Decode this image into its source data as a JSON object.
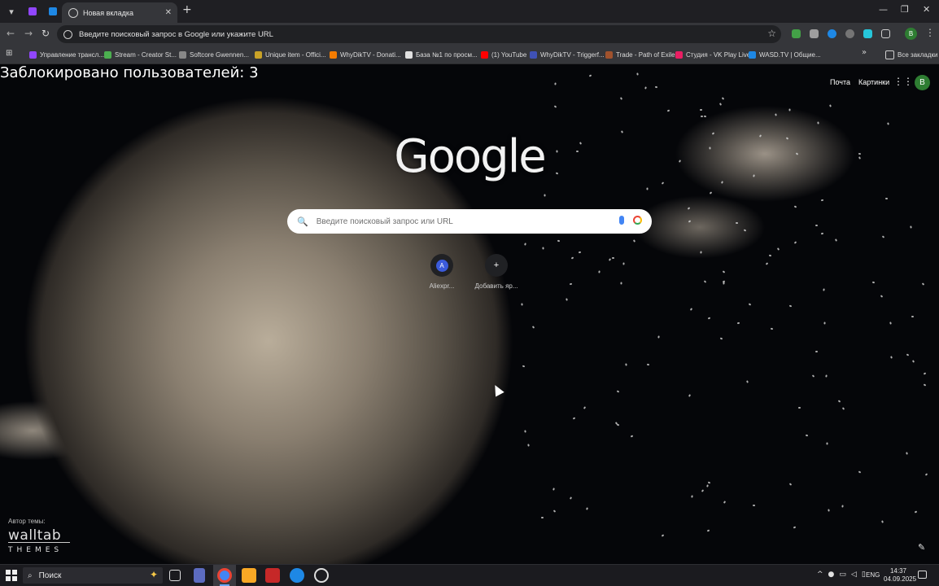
{
  "window": {
    "active_tab_title": "Новая вкладка",
    "new_tab_symbol": "+",
    "controls": {
      "minimize": "—",
      "maximize": "❐",
      "close": "✕"
    }
  },
  "toolbar": {
    "omnibox_text": "Введите поисковый запрос в Google или укажите URL",
    "profile_letter": "B"
  },
  "bookmarks": {
    "items": [
      {
        "label": "Управление трансл...",
        "color": "#9146ff"
      },
      {
        "label": "Stream - Creator St...",
        "color": "#4caf50"
      },
      {
        "label": "Softcore Gwennen...",
        "color": "#888888"
      },
      {
        "label": "Unique item - Offici...",
        "color": "#c9a227"
      },
      {
        "label": "WhyDikTV - Donati...",
        "color": "#f57c00"
      },
      {
        "label": "База №1 по просм...",
        "color": "#e0e0e0"
      },
      {
        "label": "(1) YouTube",
        "color": "#ff0000"
      },
      {
        "label": "WhyDikTV - Triggerf...",
        "color": "#3f51b5"
      },
      {
        "label": "Trade - Path of Exile",
        "color": "#a0522d"
      },
      {
        "label": "Студия - VK Play Live",
        "color": "#e91e63"
      },
      {
        "label": "WASD.TV | Общие...",
        "color": "#1e88e5"
      }
    ],
    "all_bookmarks_label": "Все закладки"
  },
  "overlay": {
    "blocked_users_text": "Заблокировано пользователей: 3"
  },
  "google": {
    "logo_text": "Google",
    "top_links": {
      "mail": "Почта",
      "images": "Картинки"
    },
    "account_letter": "B",
    "search_placeholder": "Введите поисковый запрос или URL",
    "shortcuts": [
      {
        "letter": "A",
        "label": "Aliexpr...",
        "color": "#3b5bdb"
      },
      {
        "letter": "+",
        "label": "Добавить яр..."
      }
    ]
  },
  "theme": {
    "author_label": "Автор темы:",
    "logo_main": "walltab",
    "logo_sub": "THEMES"
  },
  "taskbar": {
    "search_label": "Поиск",
    "language": "ENG",
    "time": "14:37",
    "date": "04.09.2025"
  },
  "colors": {
    "taskbar_bg": "#1b1b1f",
    "toolbar_bg": "#35363a",
    "accent_green": "#2e7d32"
  }
}
